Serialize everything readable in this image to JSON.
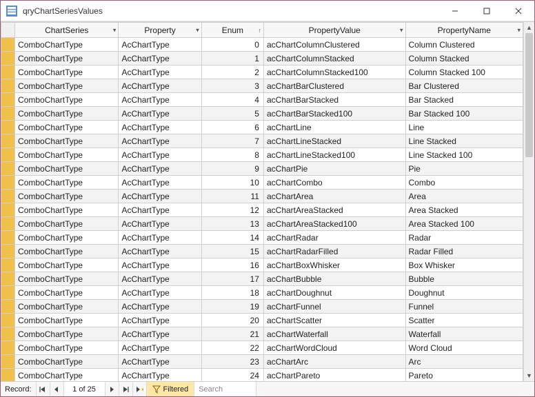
{
  "window": {
    "title": "qryChartSeriesValues"
  },
  "columns": {
    "c0": "ChartSeries",
    "c1": "Property",
    "c2": "Enum",
    "c3": "PropertyValue",
    "c4": "PropertyName",
    "sort_asc_glyph": "↑",
    "drop_glyph": "▾"
  },
  "rows": [
    {
      "series": "ComboChartType",
      "prop": "AcChartType",
      "enum": "0",
      "val": "acChartColumnClustered",
      "name": "Column Clustered"
    },
    {
      "series": "ComboChartType",
      "prop": "AcChartType",
      "enum": "1",
      "val": "acChartColumnStacked",
      "name": "Column Stacked"
    },
    {
      "series": "ComboChartType",
      "prop": "AcChartType",
      "enum": "2",
      "val": "acChartColumnStacked100",
      "name": "Column Stacked 100"
    },
    {
      "series": "ComboChartType",
      "prop": "AcChartType",
      "enum": "3",
      "val": "acChartBarClustered",
      "name": "Bar Clustered"
    },
    {
      "series": "ComboChartType",
      "prop": "AcChartType",
      "enum": "4",
      "val": "acChartBarStacked",
      "name": "Bar Stacked"
    },
    {
      "series": "ComboChartType",
      "prop": "AcChartType",
      "enum": "5",
      "val": "acChartBarStacked100",
      "name": "Bar Stacked 100"
    },
    {
      "series": "ComboChartType",
      "prop": "AcChartType",
      "enum": "6",
      "val": "acChartLine",
      "name": "Line"
    },
    {
      "series": "ComboChartType",
      "prop": "AcChartType",
      "enum": "7",
      "val": "acChartLineStacked",
      "name": "Line Stacked"
    },
    {
      "series": "ComboChartType",
      "prop": "AcChartType",
      "enum": "8",
      "val": "acChartLineStacked100",
      "name": "Line Stacked 100"
    },
    {
      "series": "ComboChartType",
      "prop": "AcChartType",
      "enum": "9",
      "val": "acChartPie",
      "name": "Pie"
    },
    {
      "series": "ComboChartType",
      "prop": "AcChartType",
      "enum": "10",
      "val": "acChartCombo",
      "name": "Combo"
    },
    {
      "series": "ComboChartType",
      "prop": "AcChartType",
      "enum": "11",
      "val": "acChartArea",
      "name": "Area"
    },
    {
      "series": "ComboChartType",
      "prop": "AcChartType",
      "enum": "12",
      "val": "acChartAreaStacked",
      "name": "Area Stacked"
    },
    {
      "series": "ComboChartType",
      "prop": "AcChartType",
      "enum": "13",
      "val": "acChartAreaStacked100",
      "name": "Area Stacked 100"
    },
    {
      "series": "ComboChartType",
      "prop": "AcChartType",
      "enum": "14",
      "val": "acChartRadar",
      "name": "Radar"
    },
    {
      "series": "ComboChartType",
      "prop": "AcChartType",
      "enum": "15",
      "val": "acChartRadarFilled",
      "name": "Radar Filled"
    },
    {
      "series": "ComboChartType",
      "prop": "AcChartType",
      "enum": "16",
      "val": "acChartBoxWhisker",
      "name": "Box Whisker"
    },
    {
      "series": "ComboChartType",
      "prop": "AcChartType",
      "enum": "17",
      "val": "acChartBubble",
      "name": "Bubble"
    },
    {
      "series": "ComboChartType",
      "prop": "AcChartType",
      "enum": "18",
      "val": "acChartDoughnut",
      "name": "Doughnut"
    },
    {
      "series": "ComboChartType",
      "prop": "AcChartType",
      "enum": "19",
      "val": "acChartFunnel",
      "name": "Funnel"
    },
    {
      "series": "ComboChartType",
      "prop": "AcChartType",
      "enum": "20",
      "val": "acChartScatter",
      "name": "Scatter"
    },
    {
      "series": "ComboChartType",
      "prop": "AcChartType",
      "enum": "21",
      "val": "acChartWaterfall",
      "name": "Waterfall"
    },
    {
      "series": "ComboChartType",
      "prop": "AcChartType",
      "enum": "22",
      "val": "acChartWordCloud",
      "name": "Word Cloud"
    },
    {
      "series": "ComboChartType",
      "prop": "AcChartType",
      "enum": "23",
      "val": "acChartArc",
      "name": "Arc"
    },
    {
      "series": "ComboChartType",
      "prop": "AcChartType",
      "enum": "24",
      "val": "acChartPareto",
      "name": "Pareto"
    }
  ],
  "nav": {
    "label": "Record:",
    "position": "1 of 25",
    "filter_label": "Filtered",
    "search_placeholder": "Search"
  }
}
